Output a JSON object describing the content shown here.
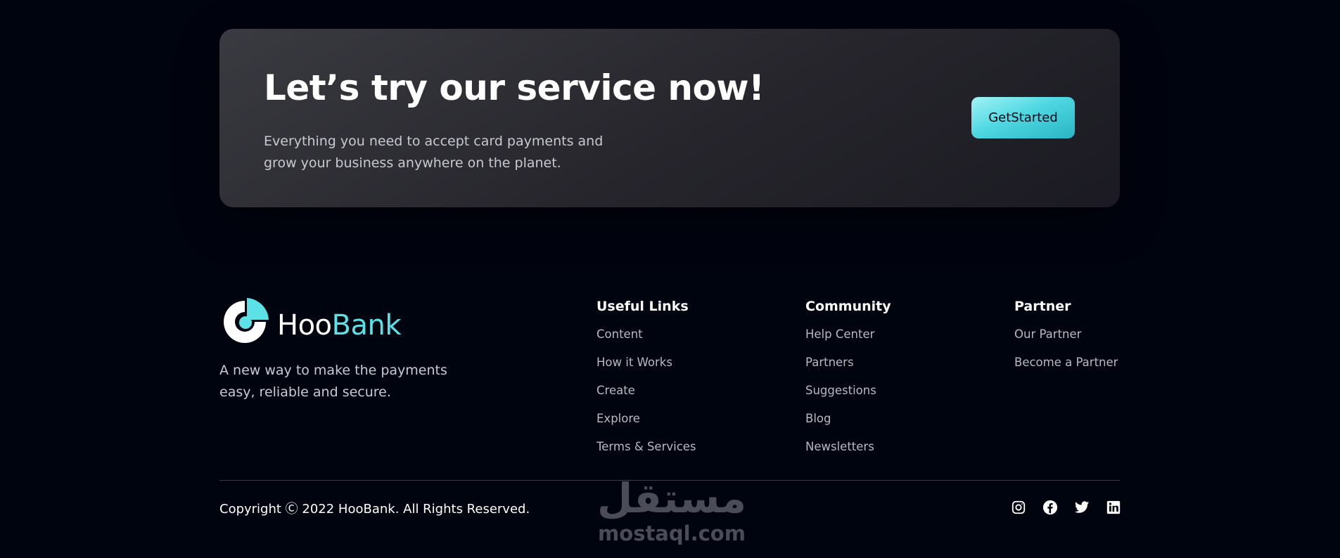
{
  "cta": {
    "title": "Let’s try our service now!",
    "description": "Everything you need to accept card payments and grow your business anywhere on the planet.",
    "button_label": "GetStarted"
  },
  "brand": {
    "logo_hoo": "Hoo",
    "logo_bank": "Bank",
    "tagline": "A new way to make the payments easy, reliable and secure."
  },
  "footer": {
    "columns": [
      {
        "title": "Useful Links",
        "links": [
          "Content",
          "How it Works",
          "Create",
          "Explore",
          "Terms & Services"
        ]
      },
      {
        "title": "Community",
        "links": [
          "Help Center",
          "Partners",
          "Suggestions",
          "Blog",
          "Newsletters"
        ]
      },
      {
        "title": "Partner",
        "links": [
          "Our Partner",
          "Become a Partner"
        ]
      }
    ],
    "copyright": "Copyright Ⓒ 2022 HooBank. All Rights Reserved.",
    "social_icons": [
      "instagram-icon",
      "facebook-icon",
      "twitter-icon",
      "linkedin-icon"
    ]
  },
  "watermark": {
    "arabic": "مستقل",
    "latin": "mostaql.com"
  },
  "colors": {
    "background": "#00040f",
    "accent": "#5ce1e6",
    "button_gradient_start": "#a2f3f6",
    "button_gradient_end": "#2ab4c4"
  }
}
